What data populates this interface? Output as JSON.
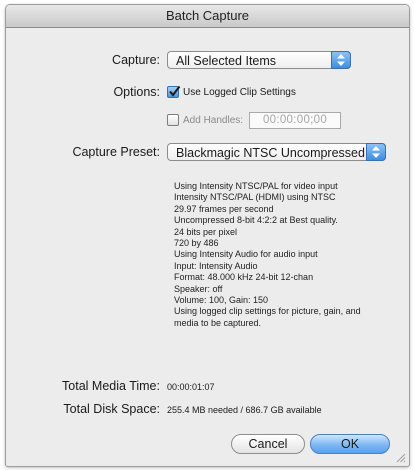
{
  "window": {
    "title": "Batch Capture"
  },
  "capture": {
    "label": "Capture:",
    "value": "All Selected Items"
  },
  "options": {
    "label": "Options:",
    "use_logged": {
      "label": "Use Logged Clip Settings",
      "checked": true
    },
    "add_handles": {
      "label": "Add Handles:",
      "checked": false,
      "timecode": "00:00:00;00"
    }
  },
  "preset": {
    "label": "Capture Preset:",
    "value": "Blackmagic NTSC Uncompressed",
    "description": [
      "Using Intensity NTSC/PAL for video input",
      "Intensity NTSC/PAL (HDMI) using NTSC",
      "29.97 frames per second",
      "Uncompressed 8-bit 4:2:2 at Best quality.",
      "24 bits per pixel",
      "720 by 486",
      "Using Intensity Audio for audio input",
      "Input: Intensity Audio",
      "Format: 48.000 kHz 24-bit 12-chan",
      "Speaker: off",
      "Volume: 100, Gain: 150",
      "Using logged clip settings for picture, gain, and",
      "media to be captured."
    ]
  },
  "totals": {
    "media_time_label": "Total Media Time:",
    "media_time_value": "00:00:01:07",
    "disk_space_label": "Total Disk Space:",
    "disk_space_value": "255.4 MB needed / 686.7 GB available"
  },
  "buttons": {
    "cancel": "Cancel",
    "ok": "OK"
  },
  "colors": {
    "accent": "#5aa0ec",
    "window_bg": "#ececec"
  },
  "icons": {
    "popup": "up-down-arrows-icon",
    "check": "checkmark-icon",
    "resize": "resize-grip-icon"
  }
}
